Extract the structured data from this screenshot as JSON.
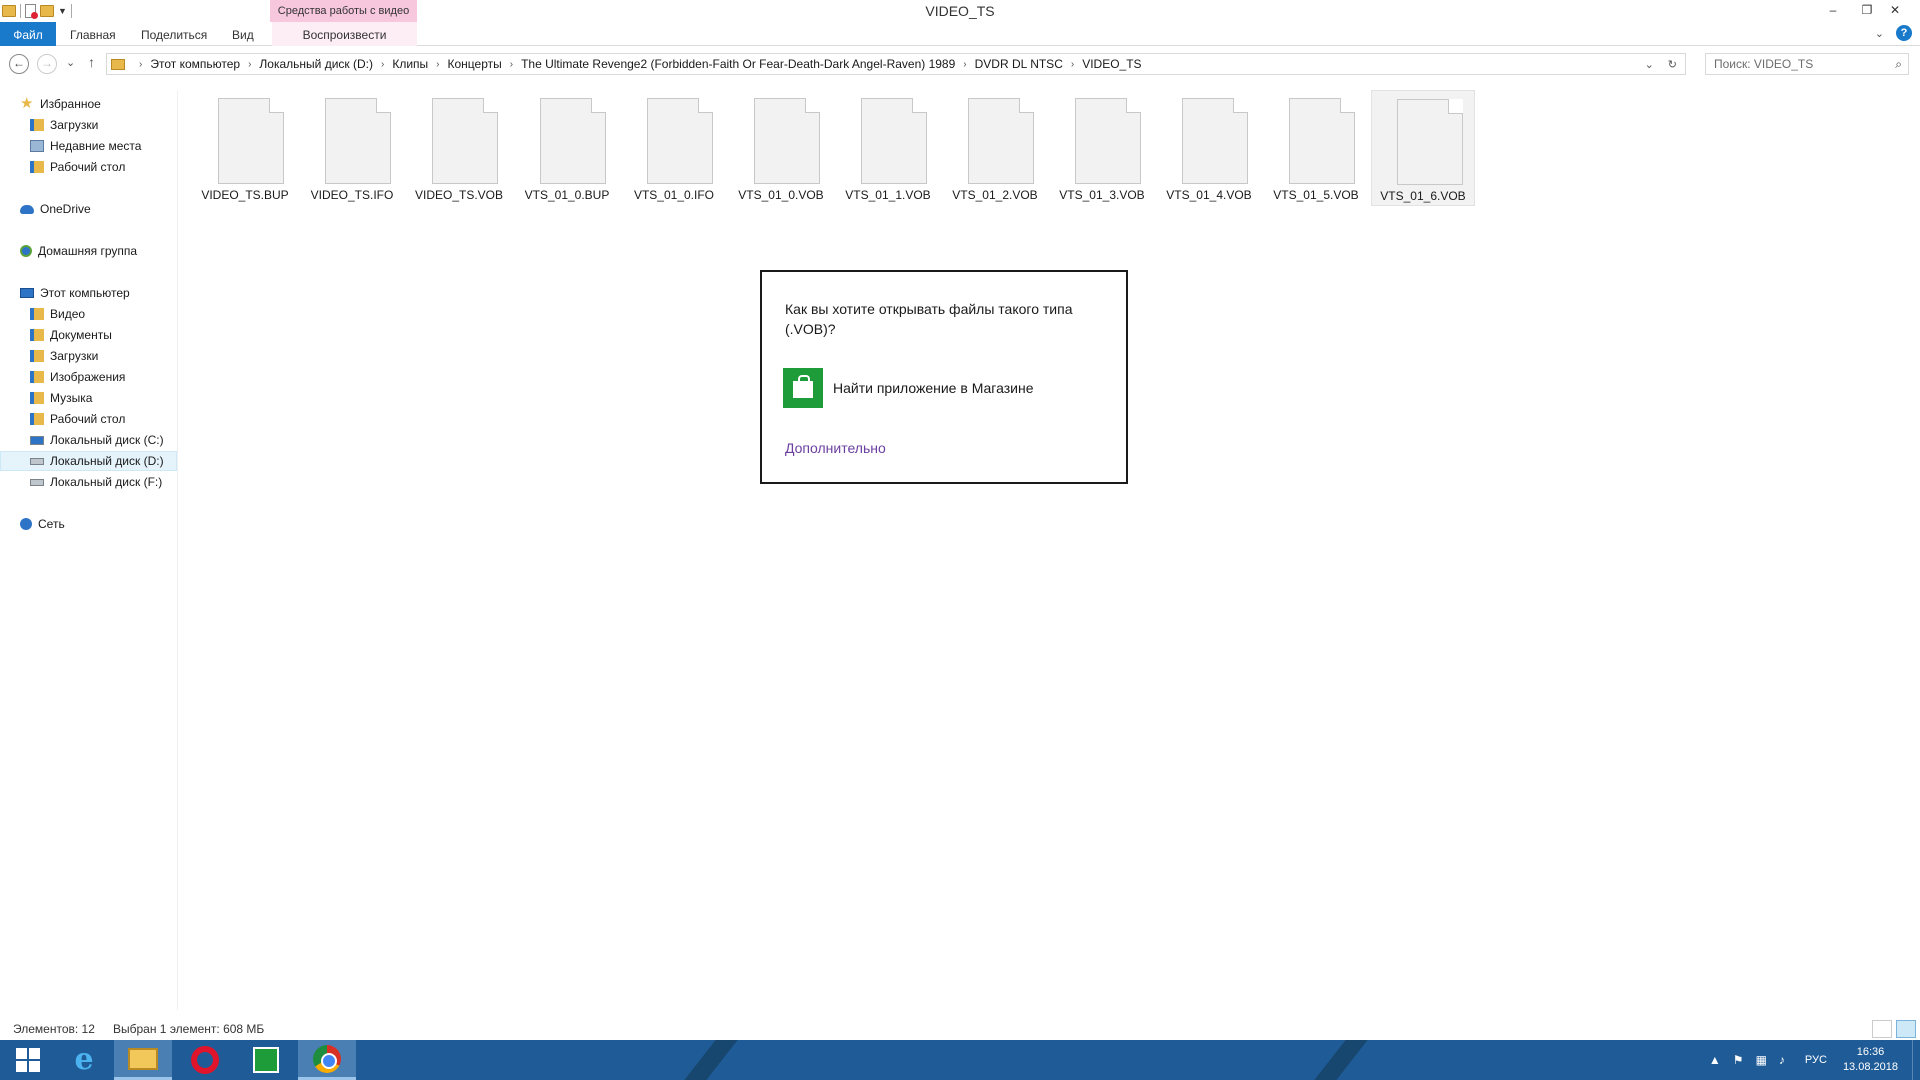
{
  "window": {
    "title": "VIDEO_TS",
    "context_tab_group": "Средства работы с видео",
    "minimize": "–",
    "restore": "❐",
    "close": "✕"
  },
  "ribbon": {
    "tabs": [
      "Файл",
      "Главная",
      "Поделиться",
      "Вид",
      "Воспроизвести"
    ],
    "help_label": "?",
    "expand_label": "⌄"
  },
  "addressbar": {
    "back": "←",
    "forward": "→",
    "recent": "⌄",
    "up": "↑",
    "breadcrumbs": [
      "Этот компьютер",
      "Локальный диск (D:)",
      "Клипы",
      "Концерты",
      "The Ultimate Revenge2 (Forbidden-Faith Or Fear-Death-Dark Angel-Raven) 1989",
      "DVDR DL NTSC",
      "VIDEO_TS"
    ],
    "separator": "›",
    "dropdown": "⌄",
    "refresh": "↻",
    "search_placeholder": "Поиск: VIDEO_TS",
    "search_icon": "⌕"
  },
  "navpane": {
    "favorites": "Избранное",
    "favorites_items": [
      "Загрузки",
      "Недавние места",
      "Рабочий стол"
    ],
    "onedrive": "OneDrive",
    "homegroup": "Домашняя группа",
    "computer": "Этот компьютер",
    "computer_items": [
      "Видео",
      "Документы",
      "Загрузки",
      "Изображения",
      "Музыка",
      "Рабочий стол",
      "Локальный диск (C:)",
      "Локальный диск (D:)",
      "Локальный диск (F:)"
    ],
    "network": "Сеть"
  },
  "files": [
    "VIDEO_TS.BUP",
    "VIDEO_TS.IFO",
    "VIDEO_TS.VOB",
    "VTS_01_0.BUP",
    "VTS_01_0.IFO",
    "VTS_01_0.VOB",
    "VTS_01_1.VOB",
    "VTS_01_2.VOB",
    "VTS_01_3.VOB",
    "VTS_01_4.VOB",
    "VTS_01_5.VOB",
    "VTS_01_6.VOB"
  ],
  "dialog": {
    "question": "Как вы хотите открывать файлы такого типа (.VOB)?",
    "store_option": "Найти приложение в Магазине",
    "more_link": "Дополнительно"
  },
  "statusbar": {
    "count": "Элементов: 12",
    "selection": "Выбран 1 элемент: 608 МБ"
  },
  "taskbar": {
    "ie_glyph": "e",
    "lang": "РУС",
    "time": "16:36",
    "date": "13.08.2018",
    "tray_up": "▲"
  },
  "colors": {
    "accent": "#1979ca",
    "context_tab": "#f6c7dd",
    "taskbar": "#1f5c97",
    "store_green": "#1e9c3a",
    "link": "#6b3fa0"
  }
}
